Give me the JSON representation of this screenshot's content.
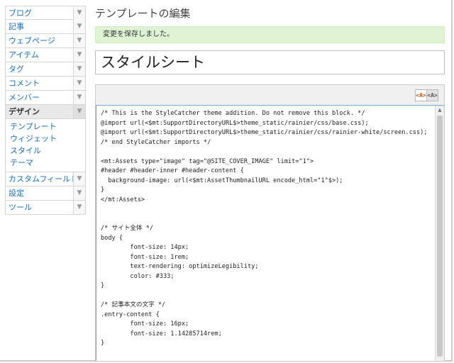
{
  "sidebar": {
    "items": [
      {
        "label": "ブログ"
      },
      {
        "label": "記事"
      },
      {
        "label": "ウェブページ"
      },
      {
        "label": "アイテム"
      },
      {
        "label": "タグ"
      },
      {
        "label": "コメント"
      },
      {
        "label": "メンバー"
      },
      {
        "label": "デザイン",
        "active": true
      },
      {
        "label": "カスタムフィールド"
      },
      {
        "label": "設定"
      },
      {
        "label": "ツール"
      }
    ],
    "design_sub": [
      {
        "label": "テンプレート"
      },
      {
        "label": "ウィジェット"
      },
      {
        "label": "スタイル"
      },
      {
        "label": "テーマ"
      }
    ],
    "arrow_glyph": "▼"
  },
  "main": {
    "title": "テンプレートの編集",
    "flash": "変更を保存しました。",
    "template_name": "スタイルシート",
    "toolbar": {
      "syntax_on_glyph": "<A>",
      "syntax_off_glyph": "<A>"
    },
    "code_lines": [
      "/* This is the StyleCatcher theme addition. Do not remove this block. */",
      "@import url(<$mt:SupportDirectoryURL$>theme_static/rainier/css/base.css);",
      "@import url(<$mt:SupportDirectoryURL$>theme_static/rainier/css/rainier-white/screen.css);",
      "/* end StyleCatcher imports */",
      "",
      "<mt:Assets type=\"image\" tag=\"@SITE_COVER_IMAGE\" limit=\"1\">",
      "#header #header-inner #header-content {",
      "  background-image: url(<$mt:AssetThumbnailURL encode_html=\"1\"$>);",
      "}",
      "</mt:Assets>",
      "",
      "",
      "/* サイト全体 */",
      "body {",
      "        font-size: 14px;",
      "        font-size: 1rem;",
      "        text-rendering: optimizeLegibility;",
      "        color: #333;",
      "}",
      "",
      "/* 記事本文の文字 */",
      ".entry-content {",
      "        font-size: 16px;",
      "        font-size: 1.14285714rem;",
      "}"
    ]
  },
  "colors": {
    "link": "#1a70b8",
    "flash_bg": "#dff3d4",
    "editor_focus": "#6fa7d8"
  }
}
